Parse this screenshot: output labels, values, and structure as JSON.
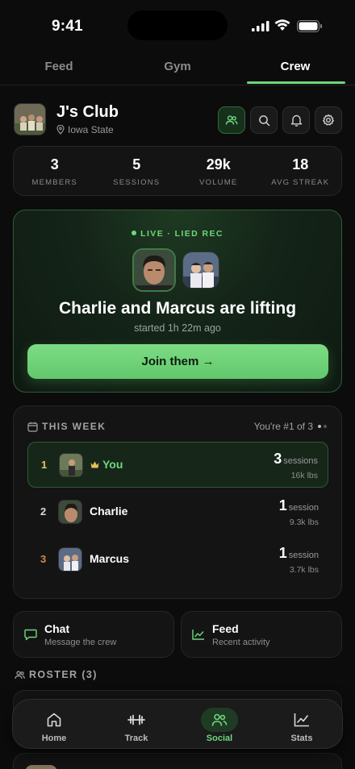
{
  "status_bar": {
    "time": "9:41"
  },
  "tabs": [
    {
      "label": "Feed"
    },
    {
      "label": "Gym"
    },
    {
      "label": "Crew",
      "active": true
    }
  ],
  "club": {
    "name": "J's Club",
    "location": "Iowa State",
    "actions": [
      "crew-icon",
      "search-icon",
      "bell-icon",
      "gear-icon"
    ]
  },
  "stats": [
    {
      "value": "3",
      "label": "MEMBERS"
    },
    {
      "value": "5",
      "label": "SESSIONS"
    },
    {
      "value": "29k",
      "label": "VOLUME"
    },
    {
      "value": "18",
      "label": "AVG STREAK"
    }
  ],
  "live": {
    "tag": "LIVE · LIED REC",
    "title": "Charlie and Marcus are lifting",
    "subtitle": "started 1h 22m ago",
    "button": "Join them →"
  },
  "week": {
    "title": "THIS WEEK",
    "rank_text": "You're #1 of 3",
    "rows": [
      {
        "rank": "1",
        "name": "You",
        "sessions": "3",
        "unit": "sessions",
        "volume": "16k lbs",
        "me": true,
        "rank_color": "#e8c15a"
      },
      {
        "rank": "2",
        "name": "Charlie",
        "sessions": "1",
        "unit": "session",
        "volume": "9.3k lbs",
        "rank_color": "#dcdcdc"
      },
      {
        "rank": "3",
        "name": "Marcus",
        "sessions": "1",
        "unit": "session",
        "volume": "3.7k lbs",
        "rank_color": "#d08a4e"
      }
    ]
  },
  "quick": [
    {
      "title": "Chat",
      "subtitle": "Message the crew",
      "icon": "chat-icon"
    },
    {
      "title": "Feed",
      "subtitle": "Recent activity",
      "icon": "chart-icon"
    }
  ],
  "roster": {
    "title": "ROSTER (3)"
  },
  "nav": [
    {
      "label": "Home",
      "icon": "home-icon"
    },
    {
      "label": "Track",
      "icon": "dumbbell-icon"
    },
    {
      "label": "Social",
      "icon": "people-icon",
      "active": true
    },
    {
      "label": "Stats",
      "icon": "stats-icon"
    }
  ],
  "colors": {
    "accent": "#6fd67d",
    "background": "#0c0c0c",
    "card": "#141414"
  }
}
